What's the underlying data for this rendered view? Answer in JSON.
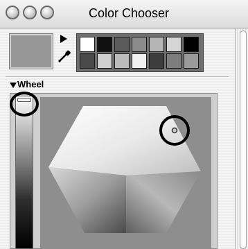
{
  "window": {
    "title": "Color Chooser"
  },
  "wheel": {
    "label": "Wheel"
  },
  "colors": {
    "selected": "#979797",
    "swatches": [
      [
        "#ffffff",
        "#111111",
        "#5a5a5a",
        "#8a8a8a",
        "#b5b5b5",
        "#d6d6d6",
        "#000000"
      ],
      [
        "#4a4a4a",
        "#cfcfcf",
        "#bcbcbc",
        "#f0f0f0",
        "#3d3d3d",
        "#7d7d7d",
        "#9a9a9a"
      ]
    ]
  },
  "icons": {
    "play": "play-icon",
    "eyedropper": "eyedropper-icon",
    "disclosure": "disclosure-triangle-icon"
  }
}
